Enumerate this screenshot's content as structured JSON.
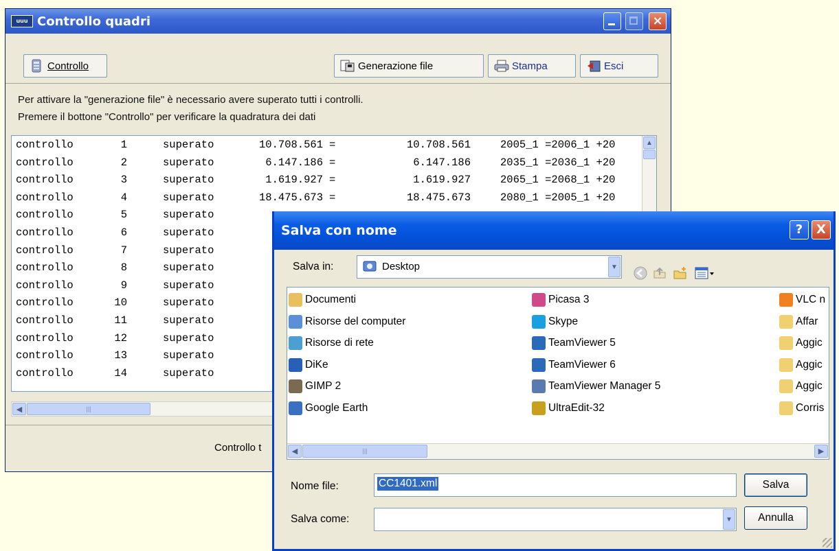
{
  "main_window": {
    "title": "Controllo quadri",
    "app_icon_text": "uuu",
    "toolbar": {
      "controllo": "Controllo",
      "generazione_file": "Generazione file",
      "stampa": "Stampa",
      "esci": "Esci"
    },
    "info_line1": "Per attivare la \"generazione file\" è necessario avere superato tutti i controlli.",
    "info_line2": "Premere il bottone \"Controllo\"  per verificare la quadratura dei dati",
    "rows": [
      {
        "label": "controllo",
        "num": "1",
        "status": "superato",
        "v1": "10.708.561",
        "eq": "=",
        "v2": "10.708.561",
        "formula": "2005_1 =2006_1 +20"
      },
      {
        "label": "controllo",
        "num": "2",
        "status": "superato",
        "v1": "6.147.186",
        "eq": "=",
        "v2": "6.147.186",
        "formula": "2035_1 =2036_1 +20"
      },
      {
        "label": "controllo",
        "num": "3",
        "status": "superato",
        "v1": "1.619.927",
        "eq": "=",
        "v2": "1.619.927",
        "formula": "2065_1 =2068_1 +20"
      },
      {
        "label": "controllo",
        "num": "4",
        "status": "superato",
        "v1": "18.475.673",
        "eq": "=",
        "v2": "18.475.673",
        "formula": "2080_1 =2005_1 +20"
      },
      {
        "label": "controllo",
        "num": "5",
        "status": "superato",
        "v1": "",
        "eq": "",
        "v2": "",
        "formula": ""
      },
      {
        "label": "controllo",
        "num": "6",
        "status": "superato",
        "v1": "",
        "eq": "",
        "v2": "",
        "formula": ""
      },
      {
        "label": "controllo",
        "num": "7",
        "status": "superato",
        "v1": "",
        "eq": "",
        "v2": "",
        "formula": ""
      },
      {
        "label": "controllo",
        "num": "8",
        "status": "superato",
        "v1": "",
        "eq": "",
        "v2": "",
        "formula": ""
      },
      {
        "label": "controllo",
        "num": "9",
        "status": "superato",
        "v1": "",
        "eq": "",
        "v2": "",
        "formula": ""
      },
      {
        "label": "controllo",
        "num": "10",
        "status": "superato",
        "v1": "",
        "eq": "",
        "v2": "",
        "formula": ""
      },
      {
        "label": "controllo",
        "num": "11",
        "status": "superato",
        "v1": "",
        "eq": "",
        "v2": "",
        "formula": ""
      },
      {
        "label": "controllo",
        "num": "12",
        "status": "superato",
        "v1": "",
        "eq": "",
        "v2": "",
        "formula": ""
      },
      {
        "label": "controllo",
        "num": "13",
        "status": "superato",
        "v1": "",
        "eq": "",
        "v2": "",
        "formula": ""
      },
      {
        "label": "controllo",
        "num": "14",
        "status": "superato",
        "v1": "",
        "eq": "",
        "v2": "",
        "formula": ""
      }
    ],
    "status_text": "Controllo t",
    "scroll_thumb_grip": "|||"
  },
  "save_dialog": {
    "title": "Salva con nome",
    "help_label": "?",
    "close_label": "X",
    "save_in_label": "Salva in:",
    "save_in_value": "Desktop",
    "files": [
      {
        "name": "Documenti",
        "icon": "folder-documents-icon",
        "color": "#e8c060"
      },
      {
        "name": "Risorse del computer",
        "icon": "computer-icon",
        "color": "#5b8fd8"
      },
      {
        "name": "Risorse di rete",
        "icon": "network-icon",
        "color": "#4aa0d0"
      },
      {
        "name": "DiKe",
        "icon": "dike-icon",
        "color": "#2860b8"
      },
      {
        "name": "GIMP 2",
        "icon": "gimp-icon",
        "color": "#7a6a50"
      },
      {
        "name": "Google Earth",
        "icon": "google-earth-icon",
        "color": "#3a70c0"
      },
      {
        "name": "Picasa 3",
        "icon": "picasa-icon",
        "color": "#d04a8a"
      },
      {
        "name": "Skype",
        "icon": "skype-icon",
        "color": "#1aa0e0"
      },
      {
        "name": "TeamViewer 5",
        "icon": "teamviewer-icon",
        "color": "#2a6ab8"
      },
      {
        "name": "TeamViewer 6",
        "icon": "teamviewer-icon",
        "color": "#2a6ab8"
      },
      {
        "name": "TeamViewer Manager 5",
        "icon": "teamviewer-manager-icon",
        "color": "#5a7ab0"
      },
      {
        "name": "UltraEdit-32",
        "icon": "ultraedit-icon",
        "color": "#c8a020"
      },
      {
        "name": "VLC n",
        "icon": "vlc-icon",
        "color": "#f08020"
      },
      {
        "name": "Affar",
        "icon": "folder-icon",
        "color": "#f0d070"
      },
      {
        "name": "Aggic",
        "icon": "folder-icon",
        "color": "#f0d070"
      },
      {
        "name": "Aggic",
        "icon": "folder-icon",
        "color": "#f0d070"
      },
      {
        "name": "Aggic",
        "icon": "folder-icon",
        "color": "#f0d070"
      },
      {
        "name": "Corris",
        "icon": "folder-icon",
        "color": "#f0d070"
      }
    ],
    "filename_label": "Nome file:",
    "filename_value": "CC1401.xml",
    "savetype_label": "Salva come:",
    "savetype_value": "",
    "save_button": "Salva",
    "cancel_button": "Annulla",
    "scroll_thumb_grip": "|||"
  },
  "colors": {
    "desktop_bg": "#ffffe8",
    "window_face": "#ece9d8",
    "title_blue": "#0a5ce4",
    "selection": "#316ac5"
  }
}
